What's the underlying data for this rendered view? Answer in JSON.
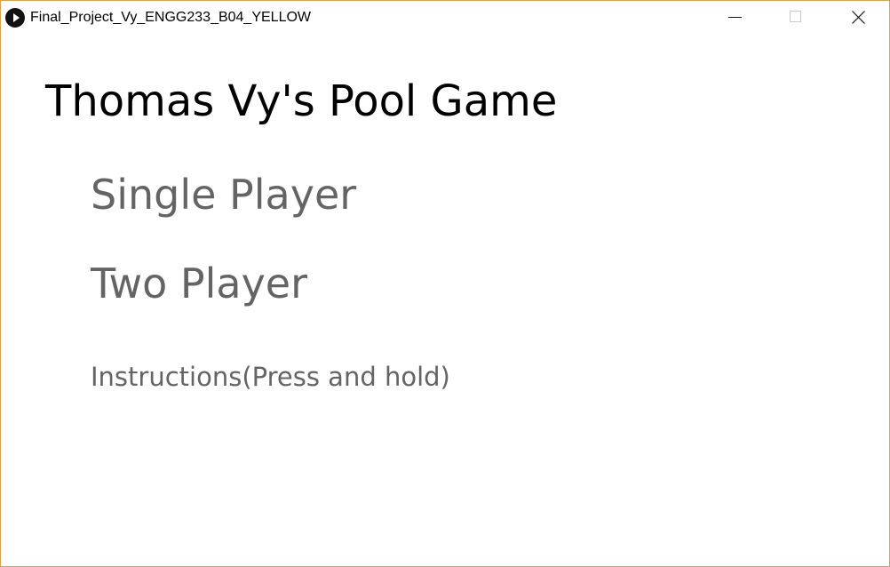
{
  "window": {
    "title": "Final_Project_Vy_ENGG233_B04_YELLOW",
    "app_icon": "play-circle-icon",
    "controls": {
      "minimize_icon": "minimize-icon",
      "maximize_icon": "maximize-icon",
      "close_icon": "close-icon"
    },
    "border_color": "#d4a24c"
  },
  "menu": {
    "title": "Thomas Vy's Pool Game",
    "options": [
      "Single Player",
      "Two Player",
      "Instructions(Press and hold)"
    ],
    "title_color": "#000000",
    "option_color": "#646464"
  }
}
